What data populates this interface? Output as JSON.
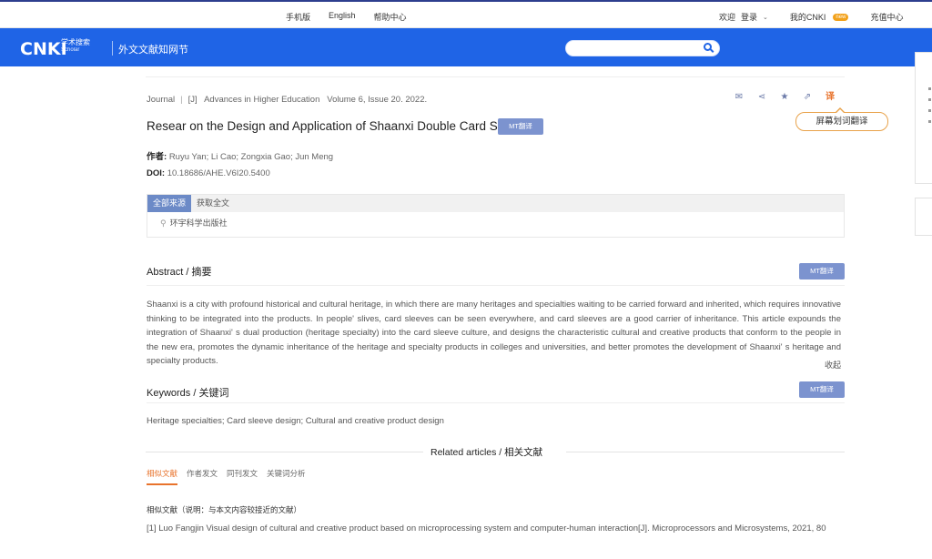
{
  "topbar": {
    "center_links": [
      "手机版",
      "English",
      "帮助中心"
    ],
    "welcome": "欢迎",
    "login": "登录",
    "wiki": "我的CNKI",
    "wiki_badge": "new",
    "recharge": "充值中心"
  },
  "header": {
    "logo": "CNKI",
    "logo_sub_cn": "学术搜索",
    "logo_sub_en": "Scholar",
    "site_name": "外文文献知网节",
    "search_placeholder": ""
  },
  "article": {
    "type": "Journal",
    "type_tag": "[J]",
    "source": "Advances in Higher Education",
    "volume": "Volume 6, Issue 20. 2022.",
    "title": "Resear on the Design and Application of Shaanxi Double Card Set",
    "mt_label": "MT翻译",
    "authors_label": "作者:",
    "authors": "Ruyu Yan; Li Cao; Zongxia Gao; Jun Meng",
    "doi_label": "DOI:",
    "doi": "10.18686/AHE.V6I20.5400"
  },
  "actions": {
    "tooltip": "屏幕划词翻译",
    "icons": [
      "mail-icon",
      "share-icon",
      "star-icon",
      "export-icon",
      "translate-icon"
    ],
    "translate_glyph": "译"
  },
  "sources": {
    "tabs": [
      "全部来源",
      "获取全文"
    ],
    "item": "环宇科学出版社"
  },
  "abstract": {
    "heading": "Abstract / 摘要",
    "mt_label": "MT翻译",
    "text": "Shaanxi is a city with profound historical and cultural heritage, in which there are many heritages and specialties waiting to be carried forward and inherited, which requires innovative thinking to be integrated into the products. In people' slives, card sleeves can be seen everywhere, and card sleeves are a good carrier of inheritance. This article expounds the integration of Shaanxi' s dual production (heritage specialty) into the card sleeve culture, and designs the characteristic cultural and creative products that conform to the people in the new era, promotes the dynamic inheritance of the heritage and specialty products in colleges and universities, and better promotes the development of Shaanxi' s heritage and specialty products.",
    "collapse": "收起"
  },
  "keywords": {
    "heading": "Keywords / 关键词",
    "mt_label": "MT翻译",
    "text": "Heritage specialties; Card sleeve design; Cultural and creative product design"
  },
  "related": {
    "heading": "Related articles / 相关文献",
    "tabs": [
      "相似文献",
      "作者发文",
      "同刊发文",
      "关键词分析"
    ],
    "note": "相似文献（说明：与本文内容较接近的文献）",
    "items": [
      "[1]  Luo Fangjin Visual design of cultural and creative product based on microprocessing system and computer-human interaction[J]. Microprocessors and Microsystems, 2021, 80"
    ]
  },
  "colors": {
    "header_blue": "#1f64e6",
    "mt_button": "#7c93cf",
    "accent_orange": "#e8732c"
  }
}
